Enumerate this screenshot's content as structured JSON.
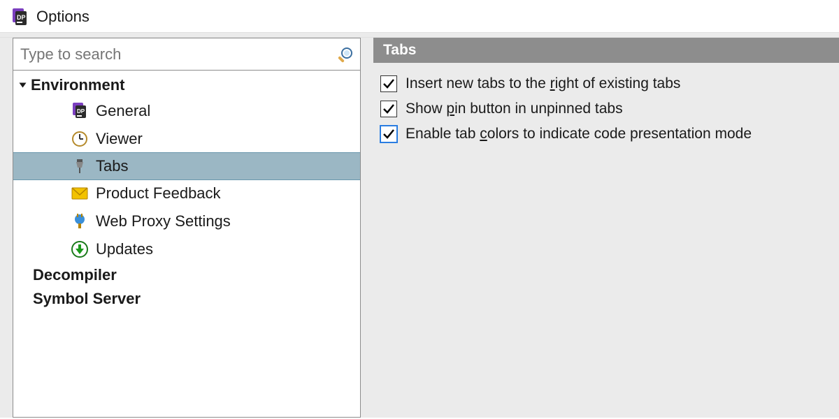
{
  "window": {
    "title": "Options"
  },
  "search": {
    "placeholder": "Type to search"
  },
  "tree": {
    "category_environment": "Environment",
    "items": {
      "general": "General",
      "viewer": "Viewer",
      "tabs": "Tabs",
      "feedback": "Product Feedback",
      "proxy": "Web Proxy Settings",
      "updates": "Updates"
    },
    "category_decompiler": "Decompiler",
    "category_symbolserver": "Symbol Server"
  },
  "right": {
    "header": "Tabs",
    "opt1_pre": "Insert new tabs to the ",
    "opt1_ul": "r",
    "opt1_post": "ight of existing tabs",
    "opt2_pre": "Show ",
    "opt2_ul": "p",
    "opt2_post": "in button in unpinned tabs",
    "opt3_pre": "Enable tab ",
    "opt3_ul": "c",
    "opt3_post": "olors to indicate code presentation mode"
  }
}
